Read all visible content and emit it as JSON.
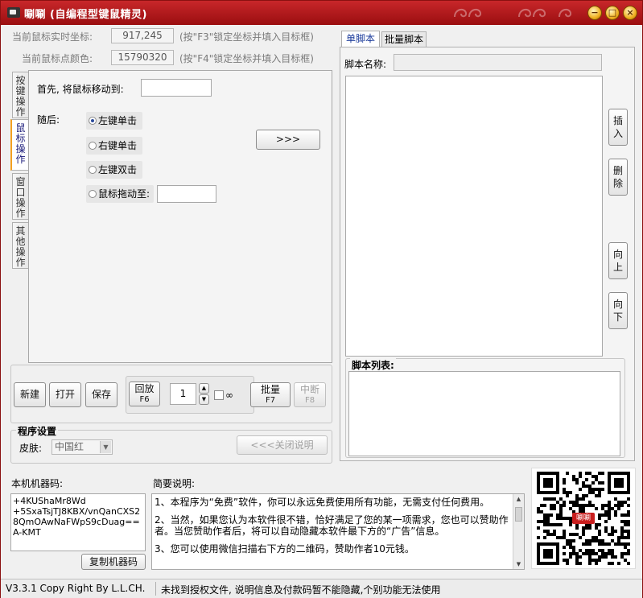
{
  "window": {
    "title": "唰唰 (自编程型键鼠精灵)",
    "icons": {
      "minimize": "minimize-icon",
      "maximize": "maximize-icon",
      "close": "close-icon"
    },
    "colors": {
      "titlebar": "#b01a1c",
      "accent": "#f4a020",
      "tab_active_text": "#1a3a9a"
    }
  },
  "coords": {
    "mouse_pos_label": "当前鼠标实时坐标:",
    "mouse_pos_value": "917,245",
    "mouse_pos_hint": "(按\"F3\"锁定坐标并填入目标框)",
    "mouse_color_label": "当前鼠标点颜色:",
    "mouse_color_value": "15790320",
    "mouse_color_hint": "(按\"F4\"锁定坐标并填入目标框)"
  },
  "side_tabs": [
    {
      "label": "按键操作",
      "lines": [
        "按",
        "键",
        "操",
        "作"
      ]
    },
    {
      "label": "鼠标操作",
      "lines": [
        "鼠",
        "标",
        "操",
        "作"
      ]
    },
    {
      "label": "窗口操作",
      "lines": [
        "窗",
        "口",
        "操",
        "作"
      ]
    },
    {
      "label": "其他操作",
      "lines": [
        "其",
        "他",
        "操",
        "作"
      ]
    }
  ],
  "mouse_panel": {
    "move_label": "首先, 将鼠标移动到:",
    "move_value": "",
    "then_label": "随后:",
    "options": [
      {
        "label": "左键单击",
        "selected": true
      },
      {
        "label": "右键单击",
        "selected": false
      },
      {
        "label": "左键双击",
        "selected": false
      },
      {
        "label": "鼠标拖动至:",
        "selected": false
      }
    ],
    "drag_value": "",
    "add_button": ">>>"
  },
  "toolbar": {
    "new": "新建",
    "open": "打开",
    "save": "保存",
    "replay": "回放",
    "replay_key": "F6",
    "repeat_value": "1",
    "infinite_label": "∞",
    "batch": "批量",
    "batch_key": "F7",
    "stop": "中断",
    "stop_key": "F8"
  },
  "settings": {
    "title": "程序设置",
    "skin_label": "皮肤:",
    "skin_value": "中国红",
    "close_help": "<<<关闭说明"
  },
  "script": {
    "tabs": [
      "单脚本",
      "批量脚本"
    ],
    "name_label": "脚本名称:",
    "name_value": "",
    "side_buttons": [
      {
        "label": "插入",
        "lines": [
          "插",
          "入"
        ]
      },
      {
        "label": "删除",
        "lines": [
          "删",
          "除"
        ]
      },
      {
        "label": "向上",
        "lines": [
          "向",
          "上"
        ]
      },
      {
        "label": "向下",
        "lines": [
          "向",
          "下"
        ]
      }
    ],
    "list_label": "脚本列表:"
  },
  "machine": {
    "label": "本机机器码:",
    "code": "+4KUShaMr8Wd\n+5SxaTsjTJ8KBX/vnQanCXS28QmOAwNaFWpS9cDuag==A-KMT",
    "copy_button": "复制机器码"
  },
  "notes": {
    "label": "简要说明:",
    "lines": [
      "1、本程序为“免费”软件，你可以永远免费使用所有功能，无需支付任何费用。",
      "2、当然，如果您认为本软件很不错，恰好满足了您的某一项需求，您也可以赞助作者。当您赞助作者后，将可以自动隐藏本软件最下方的“广告”信息。",
      "3、您可以使用微信扫描右下方的二维码，赞助作者10元钱。"
    ]
  },
  "qr": {
    "center_text": "唰唰"
  },
  "status": {
    "version": "V3.3.1 Copy Right By L.L.CH.",
    "message": "未找到授权文件, 说明信息及付款码暂不能隐藏,个别功能无法使用"
  }
}
